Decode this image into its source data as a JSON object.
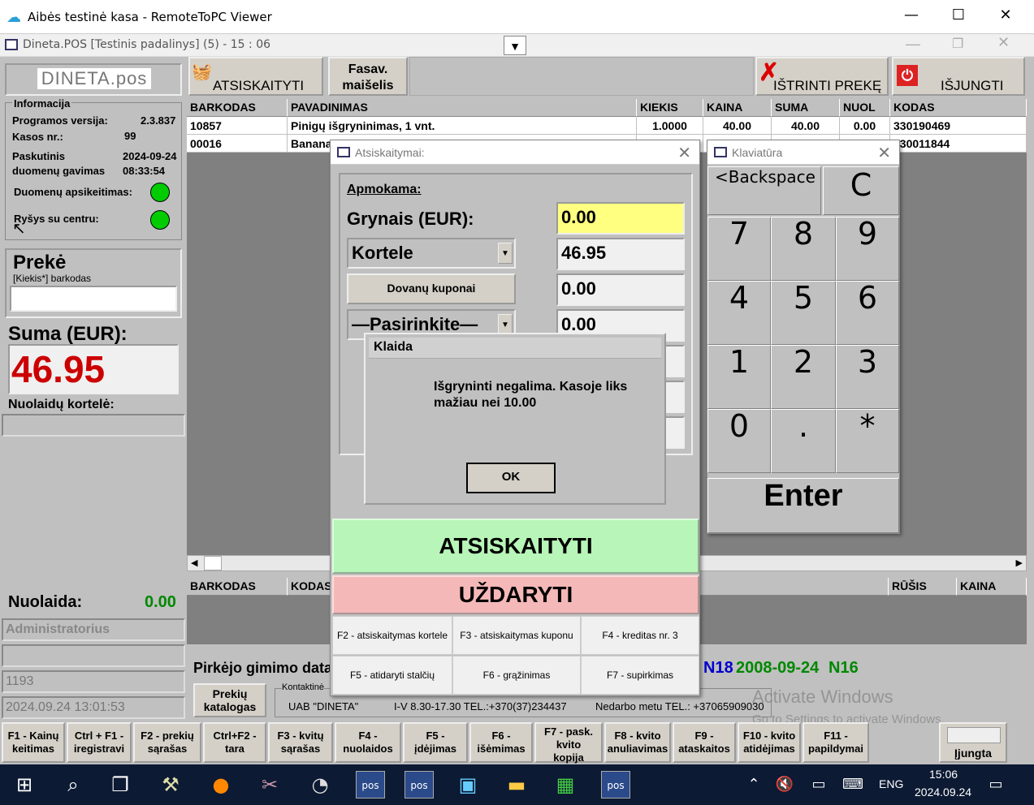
{
  "window": {
    "title": "Aibės testinė kasa - RemoteToPC Viewer",
    "inner_title": "Dineta.POS [Testinis padalinys] (5) - 15 : 06"
  },
  "logo": "DINETA.pos",
  "toolbar": {
    "pay": "ATSISKAITYTI",
    "bag_line1": "Fasav.",
    "bag_line2": "maišelis",
    "delete": "IŠTRINTI PREKĘ",
    "off": "IŠJUNGTI"
  },
  "info": {
    "legend": "Informacija",
    "version_label": "Programos versija:",
    "version": "2.3.837",
    "kasos_label": "Kasos nr.:",
    "kasos": "99",
    "last_label1": "Paskutinis",
    "last_label2": "duomenų gavimas",
    "last_date": "2024-09-24",
    "last_time": "08:33:54",
    "exchange_label": "Duomenų apsikeitimas:",
    "center_label": "Ryšys su centru:",
    "led_color": "#00cc00"
  },
  "preke": {
    "title": "Prekė",
    "hint": "[Kiekis*] barkodas",
    "value": ""
  },
  "suma": {
    "label": "Suma (EUR):",
    "value": "46.95",
    "color": "#cc0000"
  },
  "card_label": "Nuolaidų kortelė:",
  "nuolaida": {
    "label": "Nuolaida:",
    "value": "0.00"
  },
  "admin": "Administratorius",
  "num": "1193",
  "datetime": "2024.09.24 13:01:53",
  "table": {
    "headers": [
      "BARKODAS",
      "PAVADINIMAS",
      "KIEKIS",
      "KAINA",
      "SUMA",
      "NUOL",
      "KODAS"
    ],
    "rows": [
      [
        "10857",
        "Pinigų išgryninimas, 1 vnt.",
        "1.0000",
        "40.00",
        "40.00",
        "0.00",
        "330190469"
      ],
      [
        "00016",
        "Banana",
        "",
        "",
        "",
        "",
        "330011844"
      ]
    ]
  },
  "bottom_table": {
    "headers": [
      "BARKODAS",
      "KODAS",
      "RŪŠIS",
      "KAINA"
    ]
  },
  "birth": {
    "label": "Pirkėjo gimimo data",
    "n18": "N18",
    "date": "2008-09-24",
    "n16": "N16"
  },
  "katalogas_l1": "Prekių",
  "katalogas_l2": "katalogas",
  "contact": {
    "legend": "Kontaktinė",
    "company": "UAB \"DINETA\"",
    "hours": "I-V 8.30-17.30 TEL.:+370(37)234437",
    "off_hours": "Nedarbo metu TEL.: +37065909030"
  },
  "watermark": {
    "l1": "Activate Windows",
    "l2": "Go to Settings to activate Windows."
  },
  "pay_dialog": {
    "title": "Atsiskaitymai:",
    "legend": "Apmokama:",
    "cash_label": "Grynais (EUR):",
    "cash": "0.00",
    "card_sel": "Kortele",
    "card": "46.95",
    "gift_btn": "Dovanų kuponai",
    "gift": "0.00",
    "choose": "—Pasirinkite—",
    "choose_val": "0.00",
    "pay_btn": "ATSISKAITYTI",
    "close_btn": "UŽDARYTI",
    "fkeys": [
      "F2 - atsiskaitymas kortele",
      "F3 - atsiskaitymas kuponu",
      "F4 - kreditas nr. 3",
      "F5 - atidaryti stalčių",
      "F6 - grąžinimas",
      "F7 - supirkimas"
    ]
  },
  "keyboard": {
    "title": "Klaviatūra",
    "backspace": "<Backspace",
    "clear": "C",
    "keys": [
      "7",
      "8",
      "9",
      "4",
      "5",
      "6",
      "1",
      "2",
      "3",
      "0",
      ".",
      "*"
    ],
    "enter": "Enter"
  },
  "error": {
    "title": "Klaida",
    "msg1": "Išgryninti negalima. Kasoje liks",
    "msg2": "mažiau nei 10.00",
    "ok": "OK"
  },
  "fkeys": [
    [
      "F1 - Kainų",
      "keitimas"
    ],
    [
      "Ctrl + F1 -",
      "iregistravi"
    ],
    [
      "F2 - prekių",
      "sąrašas"
    ],
    [
      "Ctrl+F2 -",
      "tara"
    ],
    [
      "F3 - kvitų",
      "sąrašas"
    ],
    [
      "F4 -",
      "nuolaidos"
    ],
    [
      "F5 -",
      "įdėjimas"
    ],
    [
      "F6 -",
      "išėmimas"
    ],
    [
      "F7 - pask.",
      "kvito",
      "kopija"
    ],
    [
      "F8 - kvito",
      "anuliavimas"
    ],
    [
      "F9 -",
      "ataskaitos"
    ],
    [
      "F10 - kvito",
      "atidėjimas"
    ],
    [
      "F11 -",
      "papildymai"
    ]
  ],
  "ijungta": "Įjungta",
  "taskbar": {
    "lang": "ENG",
    "time": "15:06",
    "date": "2024.09.24"
  }
}
